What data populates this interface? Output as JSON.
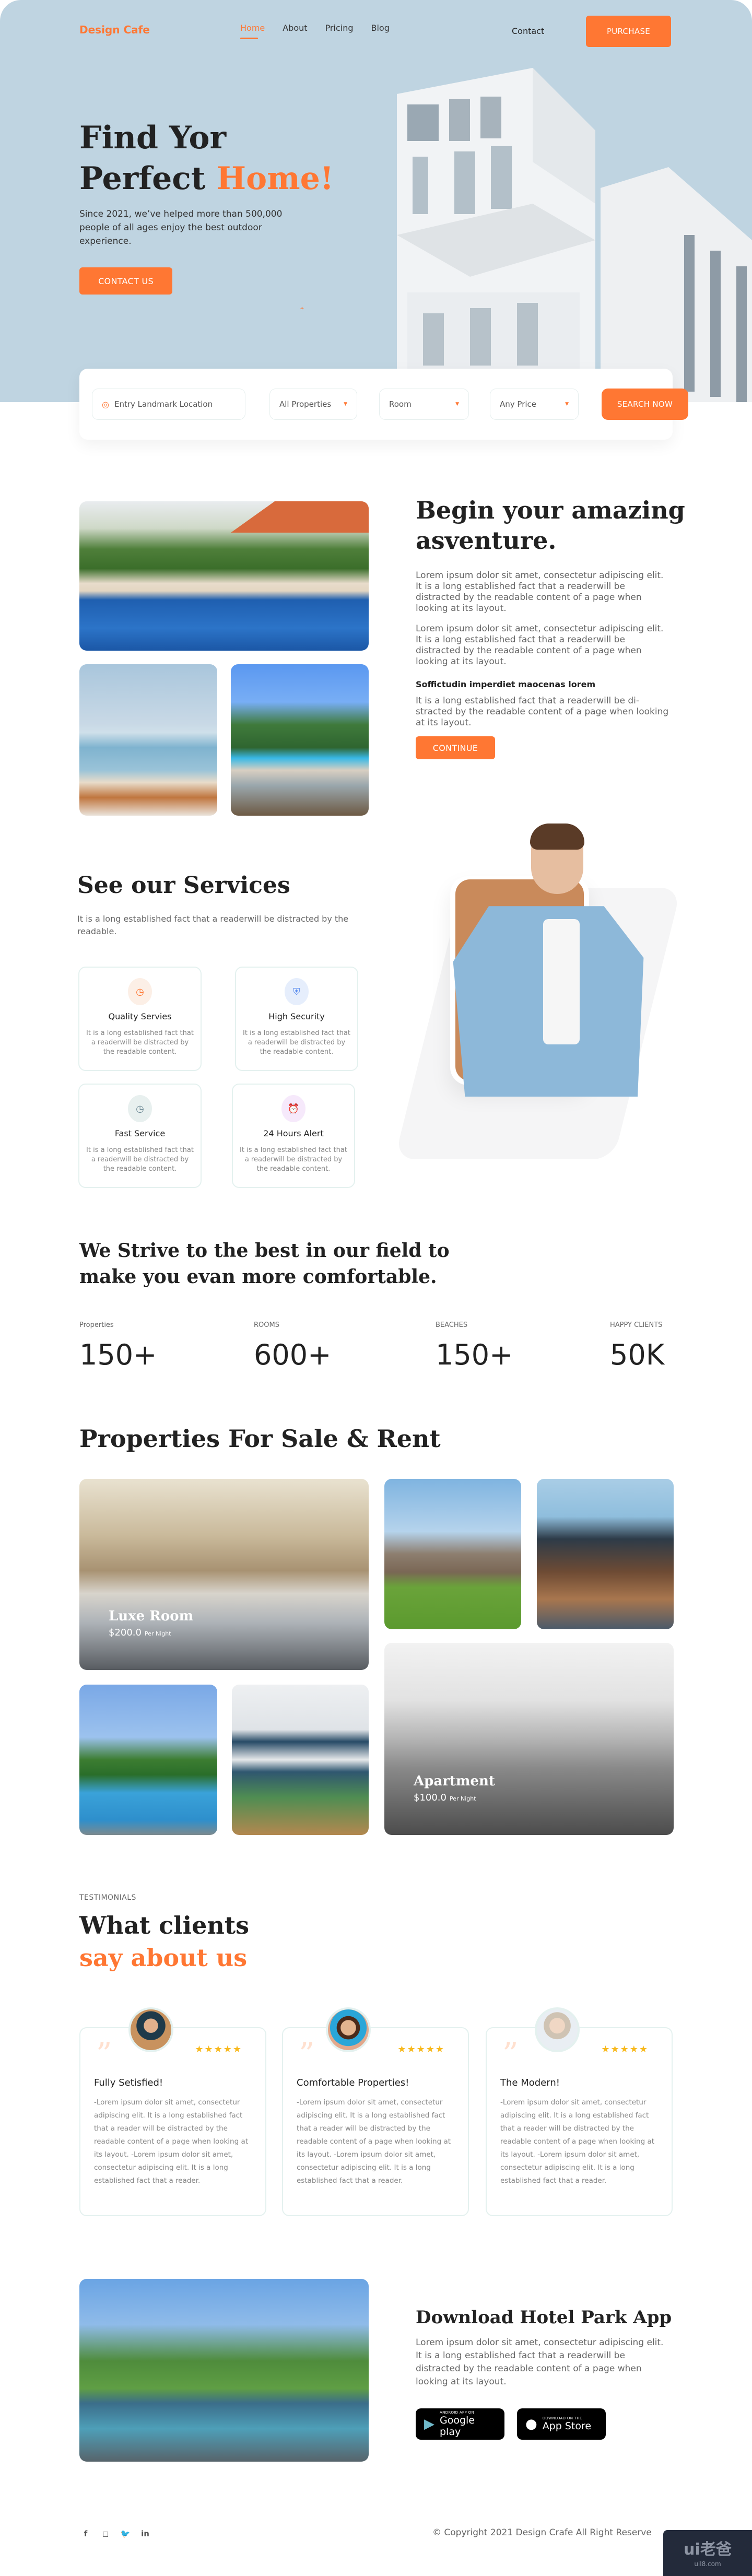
{
  "header": {
    "logo": "Design Cafe",
    "nav": [
      "Home",
      "About",
      "Pricing",
      "Blog"
    ],
    "active_nav": "Home",
    "contact": "Contact",
    "purchase": "PURCHASE"
  },
  "hero": {
    "title_line1": "Find Yor",
    "title_line2a": "Perfect ",
    "title_line2b": "Home!",
    "subtitle": "Since 2021, we’ve helped more than 500,000 people of all ages enjoy the best outdoor experience.",
    "cta": "CONTACT US"
  },
  "search": {
    "location_placeholder": "Entry Landmark Location",
    "property_type": "All Properties",
    "room": "Room",
    "price": "Any Price",
    "button": "SEARCH NOW"
  },
  "about": {
    "title_line1": "Begin your amazing",
    "title_line2": "asventure.",
    "para1": "Lorem ipsum dolor sit amet, consectetur adipiscing elit. It is a long established fact that a readerwill be distracted by the readable content of a page when looking at its layout.",
    "para2": "Lorem ipsum dolor sit amet, consectetur adipiscing elit. It is a long established fact that a readerwill be distracted by the readable content of a page when looking at its layout.",
    "subheading": "Soffictudin imperdiet maocenas lorem",
    "para3": "It is a long established fact that a readerwill be di-stracted by the readable content of a page when looking at its layout.",
    "button": "CONTINUE"
  },
  "services": {
    "title": "See our Services",
    "subtitle": "It is a long established fact that a readerwill be distracted by the readable.",
    "items": [
      {
        "name": "Quality Servies",
        "icon": "clock-icon",
        "desc": "It is a long established fact that a readerwill be distracted by the readable content.",
        "color": "#ff7733",
        "bg": "#fcefe6"
      },
      {
        "name": "High Security",
        "icon": "shield-check-icon",
        "desc": "It is a long established fact that a readerwill be distracted by the readable content.",
        "color": "#5b8def",
        "bg": "#e6eefc"
      },
      {
        "name": "Fast Service",
        "icon": "clock-icon",
        "desc": "It is a long established fact that a readerwill be distracted by the readable content.",
        "color": "#6e8a96",
        "bg": "#e8f0ef"
      },
      {
        "name": "24 Hours Alert",
        "icon": "alarm-icon",
        "desc": "It is a long established fact that a readerwill be distracted by the readable content.",
        "color": "#d4b0e0",
        "bg": "#f6e9fb"
      }
    ]
  },
  "stats": {
    "headline": "We Strive to the best in our field to make you evan more comfortable.",
    "items": [
      {
        "label": "Properties",
        "value": "150+"
      },
      {
        "label": "ROOMS",
        "value": "600+"
      },
      {
        "label": "BEACHES",
        "value": "150+"
      },
      {
        "label": "HAPPY CLIENTS",
        "value": "50K"
      }
    ]
  },
  "properties": {
    "title": "Properties For Sale & Rent",
    "featured": [
      {
        "name": "Luxe Room",
        "price": "$200.0",
        "unit": "Per Night"
      },
      {
        "name": "Apartment",
        "price": "$100.0",
        "unit": "Per Night"
      }
    ]
  },
  "testimonials": {
    "kicker": "TESTIMONIALS",
    "title_line1": "What clients",
    "title_line2": "say about us",
    "items": [
      {
        "heading": "Fully Setisfied!",
        "rating": 5,
        "stars": "★★★★★",
        "text": "-Lorem ipsum dolor sit amet, consectetur adipiscing elit. It is a long established fact that a reader will be distracted by the readable content of a page when looking at its layout. -Lorem ipsum dolor sit amet, consectetur adipiscing elit. It is a long established fact that a reader."
      },
      {
        "heading": "Comfortable Properties!",
        "rating": 5,
        "stars": "★★★★★",
        "text": "-Lorem ipsum dolor sit amet, consectetur adipiscing elit. It is a long established fact that a reader will be distracted by the readable content of a page when looking at its layout. -Lorem ipsum dolor sit amet, consectetur adipiscing elit. It is a long established fact that a reader."
      },
      {
        "heading": "The Modern!",
        "rating": 5,
        "stars": "★★★★★",
        "text": "-Lorem ipsum dolor sit amet, consectetur adipiscing elit. It is a long established fact that a reader will be distracted by the readable content of a page when looking at its layout. -Lorem ipsum dolor sit amet, consectetur adipiscing elit. It is a long established fact that a reader."
      }
    ]
  },
  "app": {
    "title": "Download Hotel Park App",
    "text": "Lorem ipsum dolor sit amet, consectetur adipiscing elit. It is a long established fact that a readerwill be distracted by the readable content of a page when looking at its layout.",
    "google_small": "ANDROID APP ON",
    "google_big": "Google play",
    "apple_small": "DOWNLOAD ON THE",
    "apple_big": "App Store"
  },
  "footer": {
    "social": [
      "facebook-icon",
      "instagram-icon",
      "twitter-icon",
      "linkedin-icon"
    ],
    "copyright": "© Copyright 2021 Design Crafe All Right Reserve"
  },
  "watermark": {
    "big": "ui老爸",
    "small": "uil8.com"
  },
  "colors": {
    "accent": "#ff7733",
    "hero_bg": "#bfd4e1",
    "star": "#f8b91d"
  }
}
